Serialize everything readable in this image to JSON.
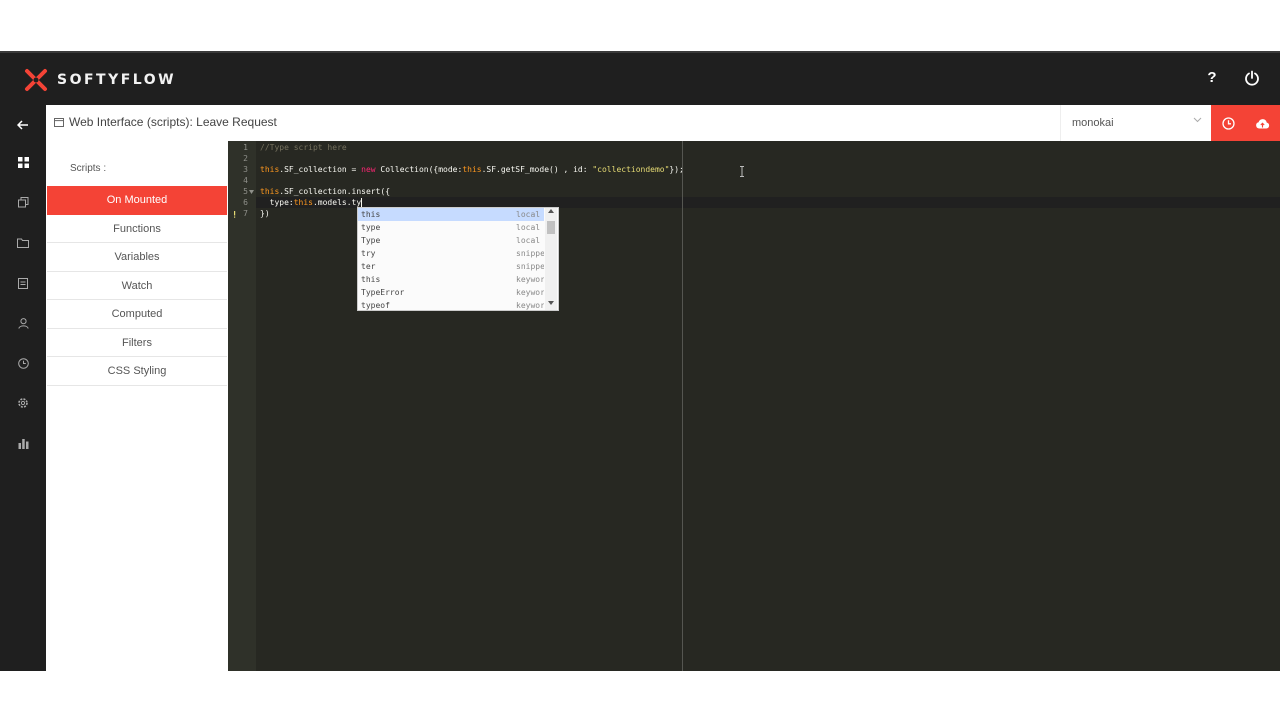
{
  "app": {
    "brand": "SOFTYFLOW",
    "help_label": "?",
    "accent_color": "#f44336"
  },
  "header": {
    "title": "Web Interface (scripts): Leave Request",
    "theme": "monokai"
  },
  "scripts": {
    "label": "Scripts :",
    "items": [
      {
        "label": "On Mounted",
        "active": true
      },
      {
        "label": "Functions",
        "active": false
      },
      {
        "label": "Variables",
        "active": false
      },
      {
        "label": "Watch",
        "active": false
      },
      {
        "label": "Computed",
        "active": false
      },
      {
        "label": "Filters",
        "active": false
      },
      {
        "label": "CSS Styling",
        "active": false
      }
    ]
  },
  "editor": {
    "line_numbers": [
      "1",
      "2",
      "3",
      "4",
      "5",
      "6",
      "7"
    ],
    "lines": {
      "l1": "//Type script here",
      "l3a": "this",
      "l3b": ".SF_collection = ",
      "l3c": "new",
      "l3d": " Collection({mode:",
      "l3e": "this",
      "l3f": ".SF.getSF_mode() , id: ",
      "l3g": "\"collectiondemo\"",
      "l3h": "});",
      "l5a": "this",
      "l5b": ".SF_collection.insert({",
      "l6a": "  type:",
      "l6b": "this",
      "l6c": ".models.ty",
      "l7": "})"
    },
    "autocomplete": [
      {
        "caption": "this",
        "meta": "local"
      },
      {
        "caption": "type",
        "meta": "local"
      },
      {
        "caption": "Type",
        "meta": "local"
      },
      {
        "caption": "try",
        "meta": "snippet"
      },
      {
        "caption": "ter",
        "meta": "snippet"
      },
      {
        "caption": "this",
        "meta": "keyword"
      },
      {
        "caption": "TypeError",
        "meta": "keyword"
      },
      {
        "caption": "typeof",
        "meta": "keyword"
      }
    ]
  },
  "icons": {
    "rail": [
      "dashboard-icon",
      "copy-icon",
      "folder-icon",
      "form-icon",
      "user-icon",
      "clock-icon",
      "settings-icon",
      "bar-chart-icon"
    ]
  }
}
